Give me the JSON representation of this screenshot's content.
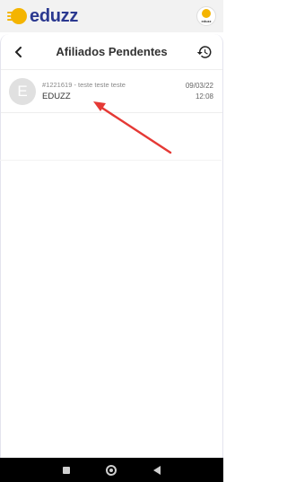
{
  "app": {
    "brand": "eduzz",
    "avatar_text": "eduzz"
  },
  "page": {
    "title": "Afiliados Pendentes"
  },
  "icons": {
    "back": "chevron-left-icon",
    "history": "history-icon"
  },
  "list": {
    "items": [
      {
        "initial": "E",
        "subtitle": "#1221619 - teste teste teste",
        "name": "EDUZZ",
        "date": "09/03/22",
        "time": "12:08"
      }
    ]
  },
  "colors": {
    "brand": "#2b3990",
    "accent": "#f4b400",
    "annotation": "#e53935"
  }
}
